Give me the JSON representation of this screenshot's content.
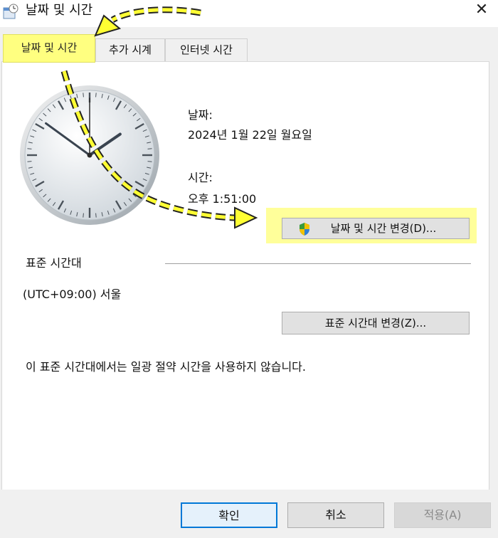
{
  "window": {
    "title": "날짜 및 시간",
    "close_glyph": "✕"
  },
  "tabs": [
    {
      "label": "날짜 및 시간",
      "active": true
    },
    {
      "label": "추가 시계"
    },
    {
      "label": "인터넷 시간"
    }
  ],
  "date_section": {
    "date_label": "날짜:",
    "date_value": "2024년 1월 22일 월요일",
    "time_label": "시간:",
    "time_value": "오후 1:51:00"
  },
  "change_datetime_button": {
    "label": "날짜 및 시간 변경(D)...",
    "icon": "uac-shield-icon"
  },
  "timezone_section": {
    "heading": "표준 시간대",
    "value": "(UTC+09:00) 서울",
    "change_button": "표준 시간대 변경(Z)...",
    "dst_note": "이 표준 시간대에서는 일광 절약 시간을 사용하지 않습니다."
  },
  "footer": {
    "ok": "확인",
    "cancel": "취소",
    "apply": "적용(A)"
  },
  "colors": {
    "highlight": "#ffff9a",
    "arrow_fill": "#ffff33",
    "arrow_outline": "#222222",
    "ok_border": "#0078d7"
  },
  "analog_clock": {
    "hours": 1,
    "minutes": 51,
    "seconds": 0
  }
}
